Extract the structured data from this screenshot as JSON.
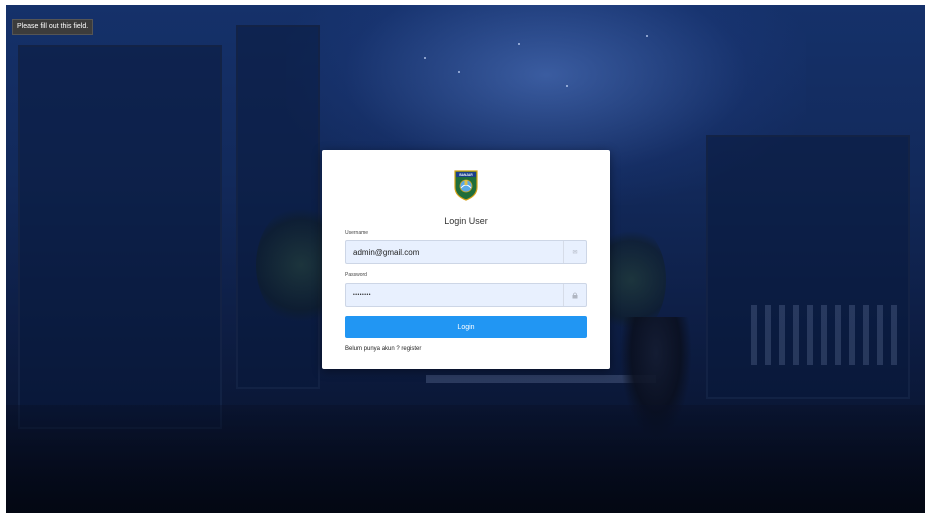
{
  "tooltip": {
    "text": "Please fill out this field."
  },
  "login": {
    "logo_text": "BANJAR",
    "title": "Login User",
    "username_label": "Username",
    "username_value": "admin@gmail.com",
    "password_label": "Password",
    "password_value": "••••••••",
    "button_label": "Login",
    "register_prompt": "Belum punya akun ? ",
    "register_link": "register"
  },
  "icons": {
    "username_addon": "envelope-icon",
    "password_addon": "lock-icon"
  },
  "colors": {
    "button": "#2196f3",
    "input_bg": "#e8f0fe",
    "card_bg": "#ffffff",
    "background": "#12295a"
  }
}
